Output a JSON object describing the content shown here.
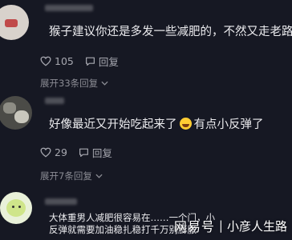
{
  "comments": [
    {
      "text": "猴子建议你还是多发一些减肥的，不然又走老路",
      "likes": "105",
      "reply_label": "回复",
      "expand_label": "展开33条回复"
    },
    {
      "text_before_emoji": "好像最近又开始吃起来了",
      "text_after_emoji": "有点小反弹了",
      "likes": "29",
      "reply_label": "回复",
      "expand_label": "展开7条回复"
    },
    {
      "text": "大体重男人减肥很容易在……一个门，小反弹就需要加油稳扎稳打千万别膨胀"
    }
  ],
  "watermark": {
    "logo": "网易号",
    "divider": "|",
    "author": "小彦人生路"
  },
  "icons": [
    "heart-icon",
    "reply-icon",
    "chevron-down-icon",
    "laughing-emoji"
  ]
}
